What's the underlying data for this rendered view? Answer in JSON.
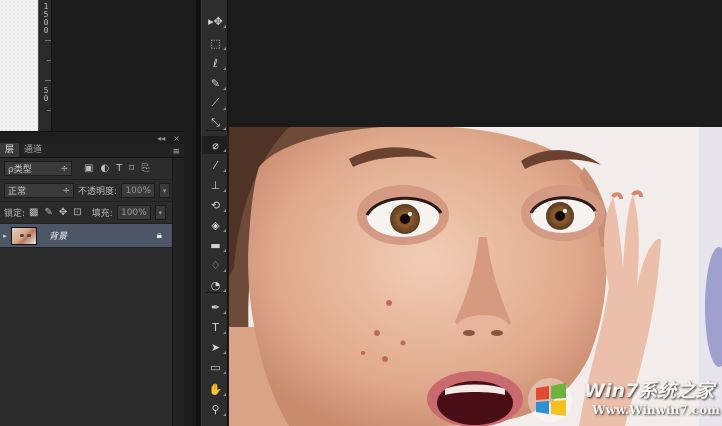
{
  "ruler": {
    "digits": [
      "1",
      "5",
      "0",
      "0",
      "5",
      "0"
    ]
  },
  "panel_controls": {
    "collapse": "◂◂",
    "close": "×",
    "menu": "≡"
  },
  "tabs": [
    {
      "label": "层",
      "active": true
    },
    {
      "label": "通道",
      "active": false
    }
  ],
  "filter": {
    "label": "ρ类型",
    "arrow": "÷"
  },
  "filter_icons": [
    "▣",
    "◐",
    "T",
    "⌑",
    "⎘"
  ],
  "blend": {
    "mode": "正常",
    "arrow": "÷",
    "opacity_label": "不透明度:",
    "opacity_value": "100%",
    "dropdown": "▾"
  },
  "lock": {
    "label": "锁定:",
    "fill_label": "填充:",
    "fill_value": "100%",
    "dropdown": "▾"
  },
  "layer": {
    "name": "背景",
    "visible_mark": "▸"
  },
  "watermark": {
    "text1": "Win7系统之家",
    "text2": "Www.Winwin7.com"
  },
  "colors": {
    "accent_layer": "#4c5667",
    "panel_bg": "#2b2b2b",
    "toolbox_bg": "#2d2d2d",
    "canvas_bg": "#1b1b1b"
  },
  "tools": [
    {
      "name": "move-tool",
      "glyph": "▸✥"
    },
    {
      "name": "marquee-tool",
      "glyph": "⬚"
    },
    {
      "name": "lasso-tool",
      "glyph": "ℓ"
    },
    {
      "name": "quick-selection-tool",
      "glyph": "✎"
    },
    {
      "name": "crop-tool",
      "glyph": "⟋"
    },
    {
      "name": "eyedropper-tool",
      "glyph": "⤡"
    },
    {
      "name": "spot-healing-tool",
      "glyph": "⌀"
    },
    {
      "name": "brush-tool",
      "glyph": "⁄"
    },
    {
      "name": "clone-stamp-tool",
      "glyph": "⊥"
    },
    {
      "name": "history-brush-tool",
      "glyph": "⟲"
    },
    {
      "name": "eraser-tool",
      "glyph": "◈"
    },
    {
      "name": "gradient-tool",
      "glyph": "▬"
    },
    {
      "name": "blur-tool",
      "glyph": "♢"
    },
    {
      "name": "dodge-tool",
      "glyph": "◔"
    },
    {
      "name": "pen-tool",
      "glyph": "✒"
    },
    {
      "name": "type-tool",
      "glyph": "T"
    },
    {
      "name": "path-selection-tool",
      "glyph": "➤"
    },
    {
      "name": "shape-tool",
      "glyph": "▭"
    },
    {
      "name": "hand-tool",
      "glyph": "✋"
    },
    {
      "name": "zoom-tool",
      "glyph": "⚲"
    }
  ]
}
